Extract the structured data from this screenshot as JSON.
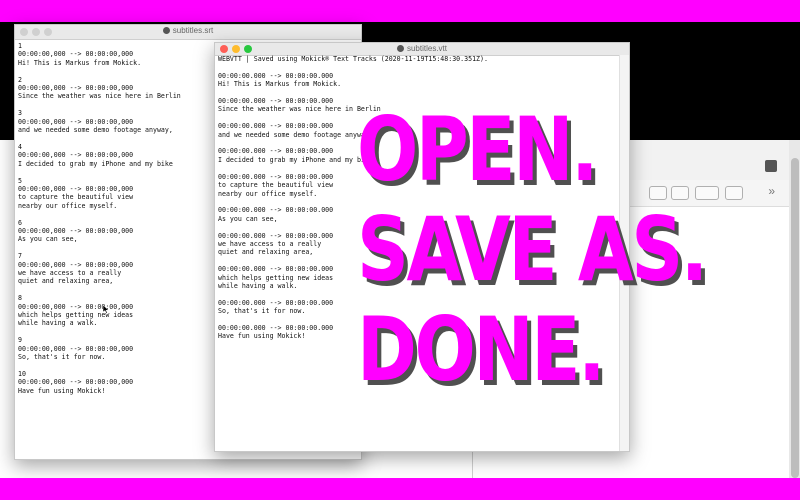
{
  "windows": {
    "srt": {
      "title": "subtitles.srt",
      "text": "1\n00:00:00,000 --> 00:00:00,000\nHi! This is Markus from Mokick.\n\n2\n00:00:00,000 --> 00:00:00,000\nSince the weather was nice here in Berlin\n\n3\n00:00:00,000 --> 00:00:00,000\nand we needed some demo footage anyway,\n\n4\n00:00:00,000 --> 00:00:00,000\nI decided to grab my iPhone and my bike\n\n5\n00:00:00,000 --> 00:00:00,000\nto capture the beautiful view\nnearby our office myself.\n\n6\n00:00:00,000 --> 00:00:00,000\nAs you can see,\n\n7\n00:00:00,000 --> 00:00:00,000\nwe have access to a really\nquiet and relaxing area,\n\n8\n00:00:00,000 --> 00:00:00,000\nwhich helps getting new ideas\nwhile having a walk.\n\n9\n00:00:00,000 --> 00:00:00,000\nSo, that's it for now.\n\n10\n00:00:00,000 --> 00:00:00,000\nHave fun using Mokick!"
    },
    "vtt": {
      "title": "subtitles.vtt",
      "text": "WEBVTT | Saved using Mokick® Text Tracks (2020-11-19T15:48:30.351Z).\n\n00:00:00.000 --> 00:00:00.000\nHi! This is Markus from Mokick.\n\n00:00:00.000 --> 00:00:00.000\nSince the weather was nice here in Berlin\n\n00:00:00.000 --> 00:00:00.000\nand we needed some demo footage anyway,\n\n00:00:00.000 --> 00:00:00.000\nI decided to grab my iPhone and my bike\n\n00:00:00.000 --> 00:00:00.000\nto capture the beautiful view\nnearby our office myself.\n\n00:00:00.000 --> 00:00:00.000\nAs you can see,\n\n00:00:00.000 --> 00:00:00.000\nwe have access to a really\nquiet and relaxing area,\n\n00:00:00.000 --> 00:00:00.000\nwhich helps getting new ideas\nwhile having a walk.\n\n00:00:00.000 --> 00:00:00.000\nSo, that's it for now.\n\n00:00:00.000 --> 00:00:00.000\nHave fun using Mokick!"
    }
  },
  "headline": {
    "line1": "OPEN.",
    "line2": "SAVE AS.",
    "line3": "DONE."
  },
  "background_toolbar": {
    "more": "»"
  },
  "colors": {
    "accent": "#ff00ff",
    "traffic_close": "#fe5f57",
    "traffic_minimize": "#febc2e",
    "traffic_zoom": "#28c840",
    "traffic_inactive": "#d0d0d0"
  },
  "icons": [
    "document-icon",
    "save-icon",
    "share-icon",
    "tag-icon",
    "list-icon",
    "folder-icon",
    "mouse-cursor-icon"
  ]
}
